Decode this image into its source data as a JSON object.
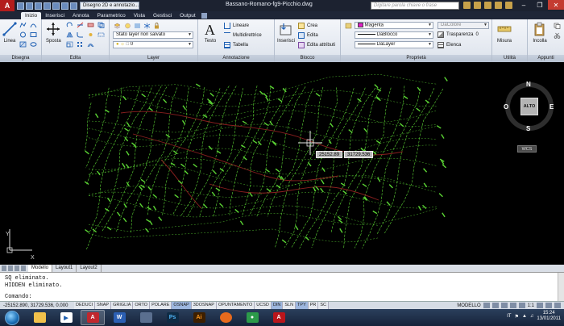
{
  "titlebar": {
    "app_button": "A",
    "workspace": "Disegno 2D e annotazio...",
    "document_title": "Bassano-Romano-fg9-Picchio.dwg",
    "search_placeholder": "Digitare parola chiave o frase"
  },
  "tabs": [
    "Inizio",
    "Inserisci",
    "Annota",
    "Parametrico",
    "Vista",
    "Gestisci",
    "Output"
  ],
  "ribbon": {
    "draw": {
      "title": "Disegna",
      "line_label": "Linea"
    },
    "modify": {
      "title": "Edita",
      "move_label": "Sposta"
    },
    "layer": {
      "title": "Layer",
      "layer_state": "Stato layer non salvato",
      "current_layer": "0"
    },
    "annotation": {
      "title": "Annotazione",
      "text_label": "Testo",
      "linear_label": "Lineare",
      "mleader_label": "Multidirettrice",
      "table_label": "Tabella"
    },
    "block": {
      "title": "Blocco",
      "insert_label": "Inserisci",
      "create_label": "Crea",
      "edit_label": "Edita",
      "edit_attr_label": "Edita attributi"
    },
    "properties": {
      "title": "Proprietà",
      "color": "Magenta",
      "linetype": "DaBlocco",
      "lineweight": "DaLayer",
      "plotstyle": "DaColore",
      "transparency_label": "Trasparenza",
      "transparency_value": "0",
      "list_label": "Elenca"
    },
    "utilities": {
      "title": "Utilità",
      "measure_label": "Misura"
    },
    "clipboard": {
      "title": "Appunti",
      "paste_label": "Incolla"
    }
  },
  "drawing": {
    "cursor_x": "25152.89",
    "cursor_y": "31729.536",
    "viewcube": {
      "north": "N",
      "south": "S",
      "east": "E",
      "west": "O",
      "face": "ALTO",
      "wcs": "WCS"
    }
  },
  "layout_tabs": [
    "Modello",
    "Layout1",
    "Layout2"
  ],
  "command": {
    "history": [
      "SQ eliminato.",
      "HIDDEN eliminato."
    ],
    "prompt": "Comando:"
  },
  "statusbar": {
    "coords": "-25152.890, 31729.536, 0.000",
    "toggles": [
      "DEDUCI",
      "SNAP",
      "GRIGLIA",
      "ORTO",
      "POLARE",
      "OSNAP",
      "3DOSNAP",
      "OPUNTAMENTO",
      "UCSD",
      "DIN",
      "SLN",
      "TPY",
      "PR",
      "SC"
    ],
    "toggles_on": [
      "OSNAP",
      "DIN",
      "TPY"
    ],
    "model_label": "MODELLO",
    "scale": "1:1"
  },
  "taskbar": {
    "language": "IT",
    "time": "15:24",
    "date": "13/01/2011",
    "apps": [
      "explorer-icon",
      "media-player-icon",
      "autocad-icon",
      "word-icon",
      "generic-app-icon",
      "photoshop-icon",
      "illustrator-icon",
      "firefox-icon",
      "media-icon",
      "acrobat-icon"
    ]
  },
  "colors": {
    "contour": "#5bd434",
    "road": "#8a1f1f",
    "crosshair": "#e6e6e6",
    "ribbon_bg": "#e5eaf1",
    "title_bg": "#1c2230"
  }
}
